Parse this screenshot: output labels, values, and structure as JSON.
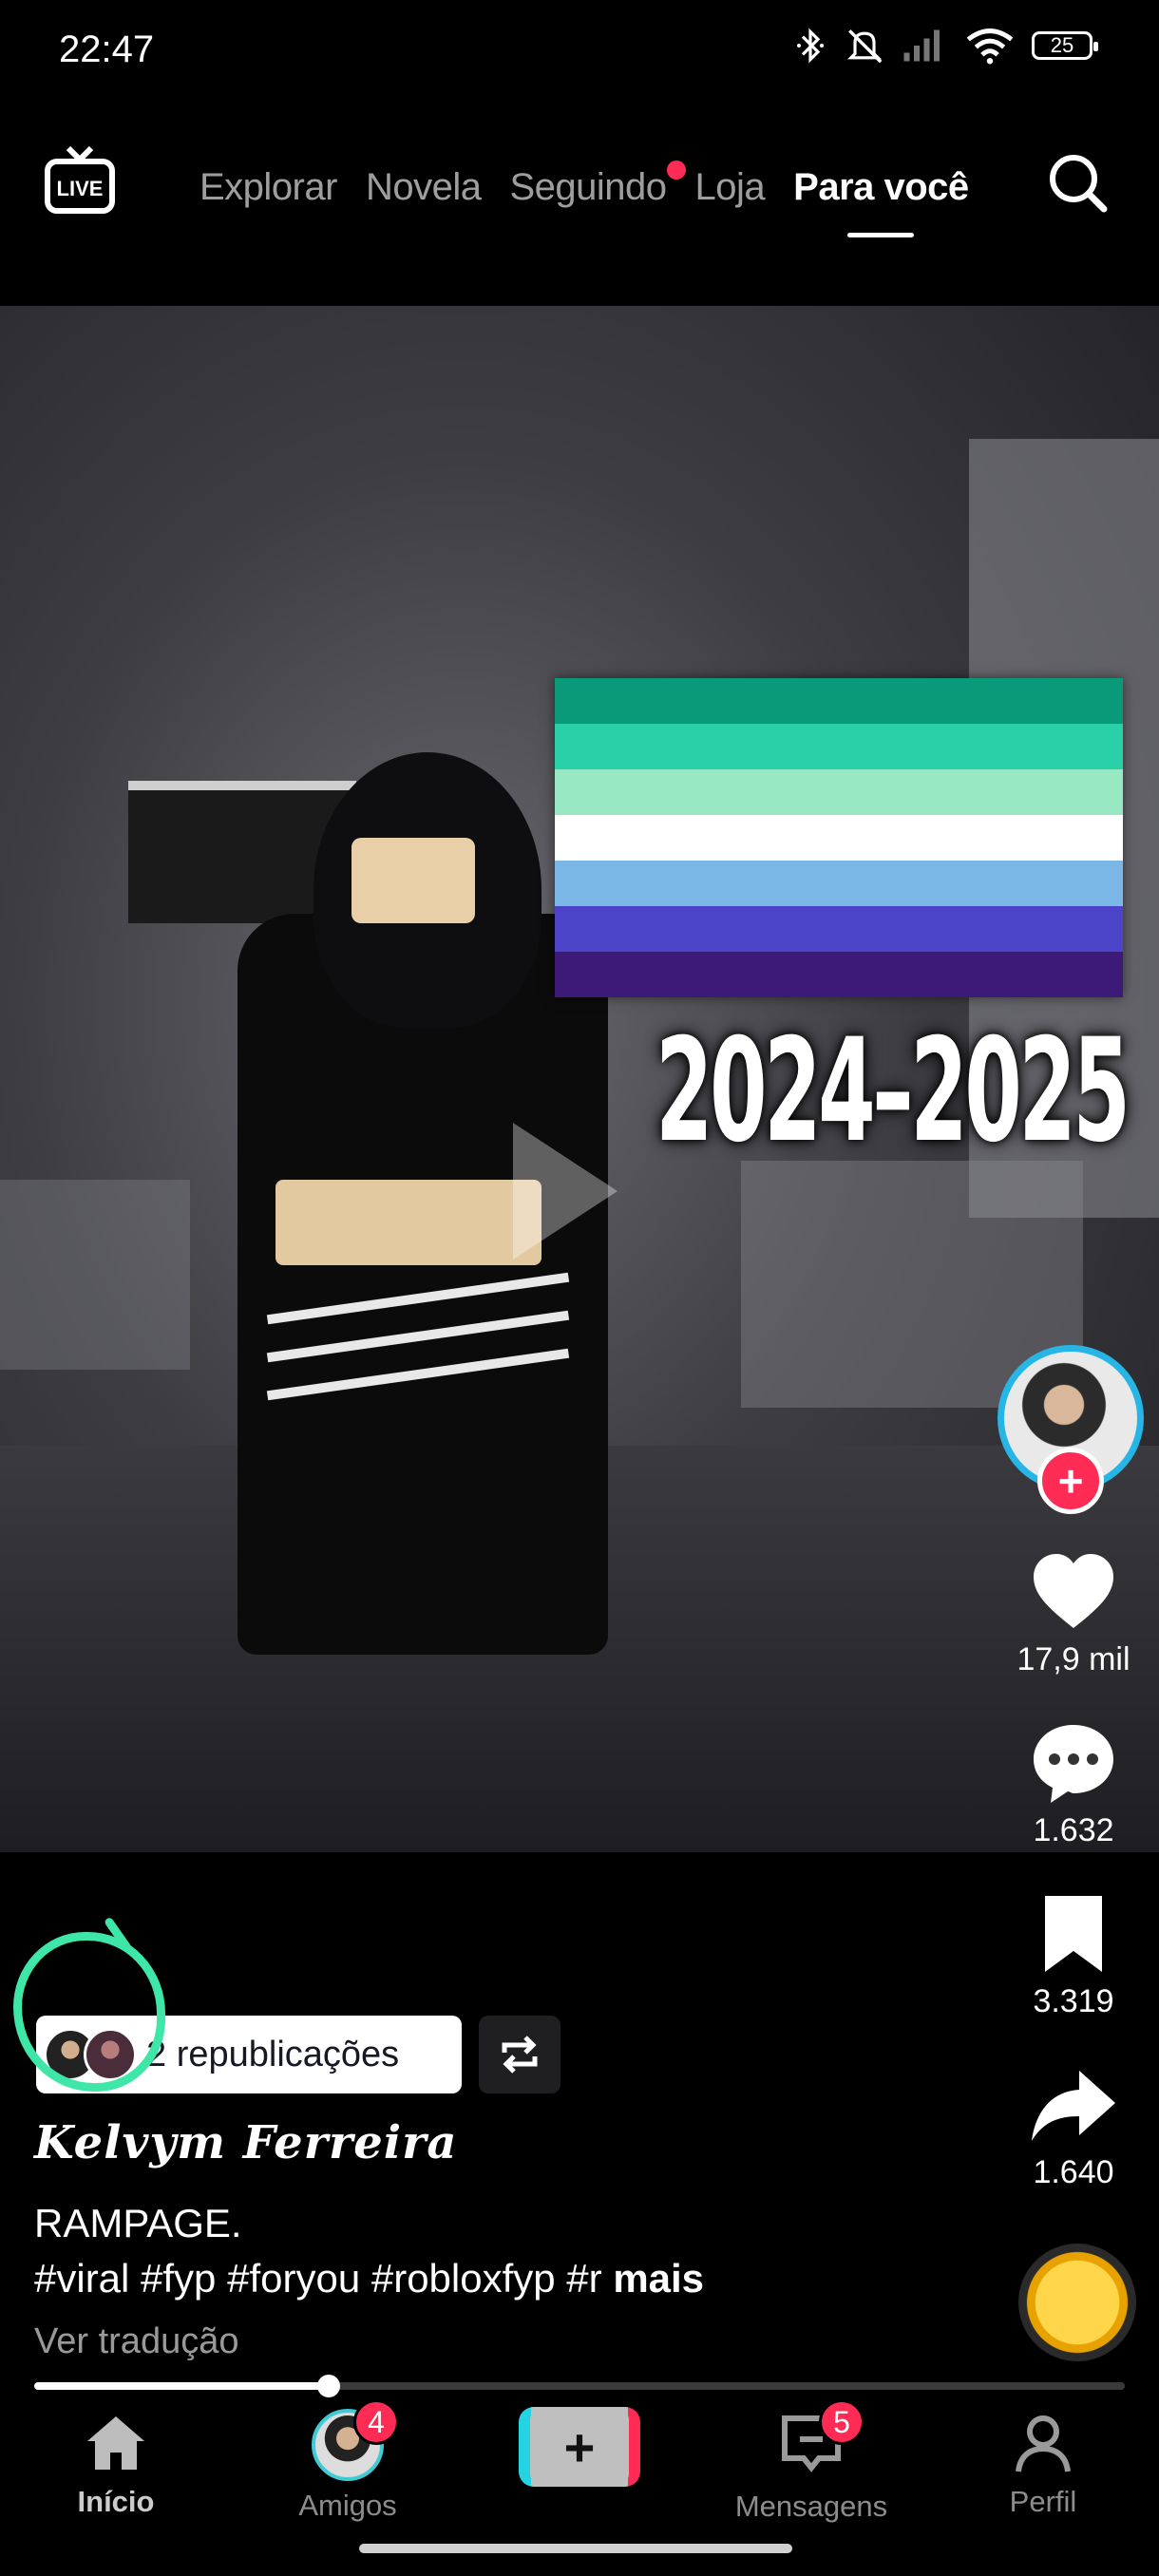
{
  "status_bar": {
    "time": "22:47",
    "battery": "25",
    "icons": [
      "bluetooth-icon",
      "mute-icon",
      "signal-icon",
      "wifi-icon",
      "battery-icon"
    ]
  },
  "top_nav": {
    "live_label": "LIVE",
    "tabs": [
      {
        "label": "Explorar"
      },
      {
        "label": "Novela"
      },
      {
        "label": "Seguindo"
      },
      {
        "label": "Loja"
      },
      {
        "label": "Para você"
      }
    ],
    "active_tab": "Para você"
  },
  "video": {
    "overlay_text": "2024–2025",
    "flag_colors": [
      "#0a9a7a",
      "#2ad0a8",
      "#98e8c4",
      "#ffffff",
      "#7bb7e6",
      "#4c44c8",
      "#3d1a78"
    ]
  },
  "right_rail": {
    "likes": "17,9 mil",
    "comments": "1.632",
    "saves": "3.319",
    "shares": "1.640"
  },
  "post": {
    "republications": "2 republicações",
    "username": "Kelvym Ferreira",
    "caption_line1": "RAMPAGE.",
    "caption_line2": "#viral #fyp #foryou #robloxfyp #r",
    "more_label": "mais",
    "translate_label": "Ver tradução",
    "progress": 0.27
  },
  "bottom_nav": {
    "items": [
      {
        "label": "Início",
        "badge": ""
      },
      {
        "label": "Amigos",
        "badge": "4"
      },
      {
        "label": "",
        "badge": ""
      },
      {
        "label": "Mensagens",
        "badge": "5"
      },
      {
        "label": "Perfil",
        "badge": ""
      }
    ]
  },
  "colors": {
    "accent": "#fe2c55",
    "annotation": "#3ee6a8",
    "avatar_ring": "#27b5e6"
  }
}
